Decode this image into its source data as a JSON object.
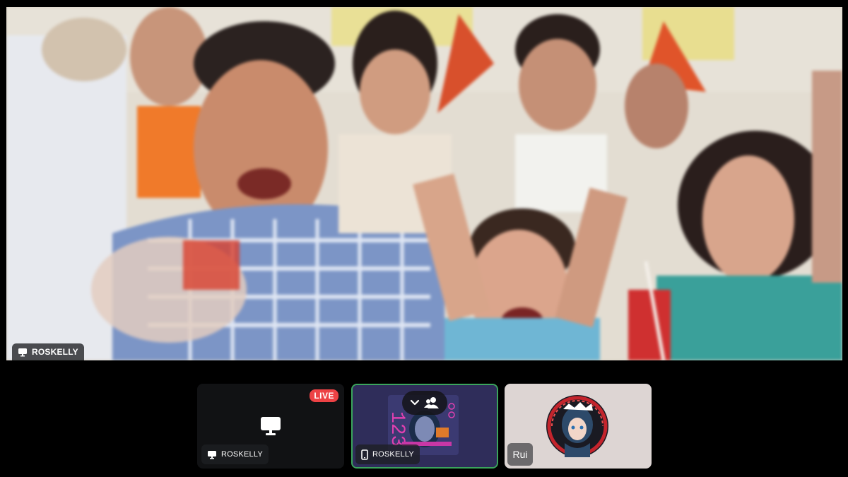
{
  "stage": {
    "user_label": "ROSKELLY",
    "icon": "monitor-icon"
  },
  "tiles": [
    {
      "user_label": "ROSKELLY",
      "icon": "monitor-icon",
      "badge": "LIVE"
    },
    {
      "user_label": "ROSKELLY",
      "icon": "mobile-phone-icon",
      "controls": [
        "chevron-down-icon",
        "people-icon"
      ]
    },
    {
      "user_label": "Rui",
      "icon": "avatar"
    }
  ],
  "colors": {
    "live": "#ed4245",
    "speaking_border": "#3ba55c",
    "tile_bg": "#111214"
  }
}
